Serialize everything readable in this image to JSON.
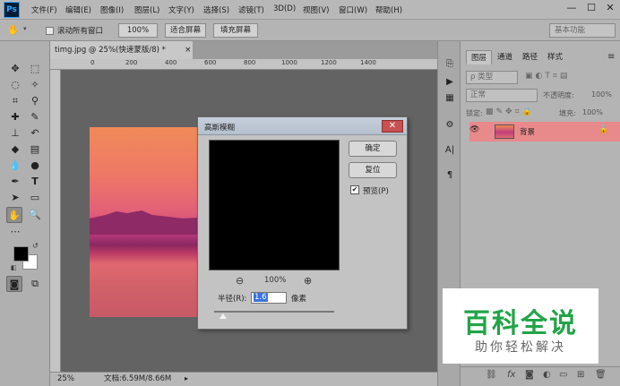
{
  "menu": {
    "logo": "Ps",
    "items": [
      "文件(F)",
      "编辑(E)",
      "图像(I)",
      "图层(L)",
      "文字(Y)",
      "选择(S)",
      "滤镜(T)",
      "3D(D)",
      "视图(V)",
      "窗口(W)",
      "帮助(H)"
    ],
    "window_controls": [
      "—",
      "☐",
      "✕"
    ]
  },
  "options": {
    "scroll_all_label": "滚动所有窗口",
    "zoom_value": "100%",
    "fit_screen": "适合屏幕",
    "fill_screen": "填充屏幕",
    "workspace": "基本功能"
  },
  "document": {
    "tab_title": "timg.jpg @ 25%(快速蒙版/8) *",
    "ruler_labels": [
      "0",
      "200",
      "400",
      "600",
      "800",
      "1000",
      "1200",
      "1400"
    ],
    "status_zoom": "25%",
    "status_doc": "文档:6.59M/8.66M"
  },
  "dialog": {
    "title": "高斯模糊",
    "ok": "确定",
    "reset": "复位",
    "preview_label": "预览(P)",
    "preview_checked": true,
    "zoom_level": "100%",
    "radius_label": "半径(R):",
    "radius_value": "1.6",
    "radius_unit": "像素"
  },
  "layers": {
    "tabs": [
      "图层",
      "通道",
      "路径",
      "样式"
    ],
    "kind_filter": "ρ 类型",
    "blend_mode": "正常",
    "opacity_label": "不透明度:",
    "opacity_value": "100%",
    "lock_label": "锁定:",
    "fill_label": "填充:",
    "fill_value": "100%",
    "layer_name": "背景"
  },
  "watermark": {
    "title": "百科全说",
    "subtitle": "助你轻松解决"
  },
  "colors": {
    "layer_highlight": "#e8898b",
    "watermark_green": "#22a447"
  }
}
